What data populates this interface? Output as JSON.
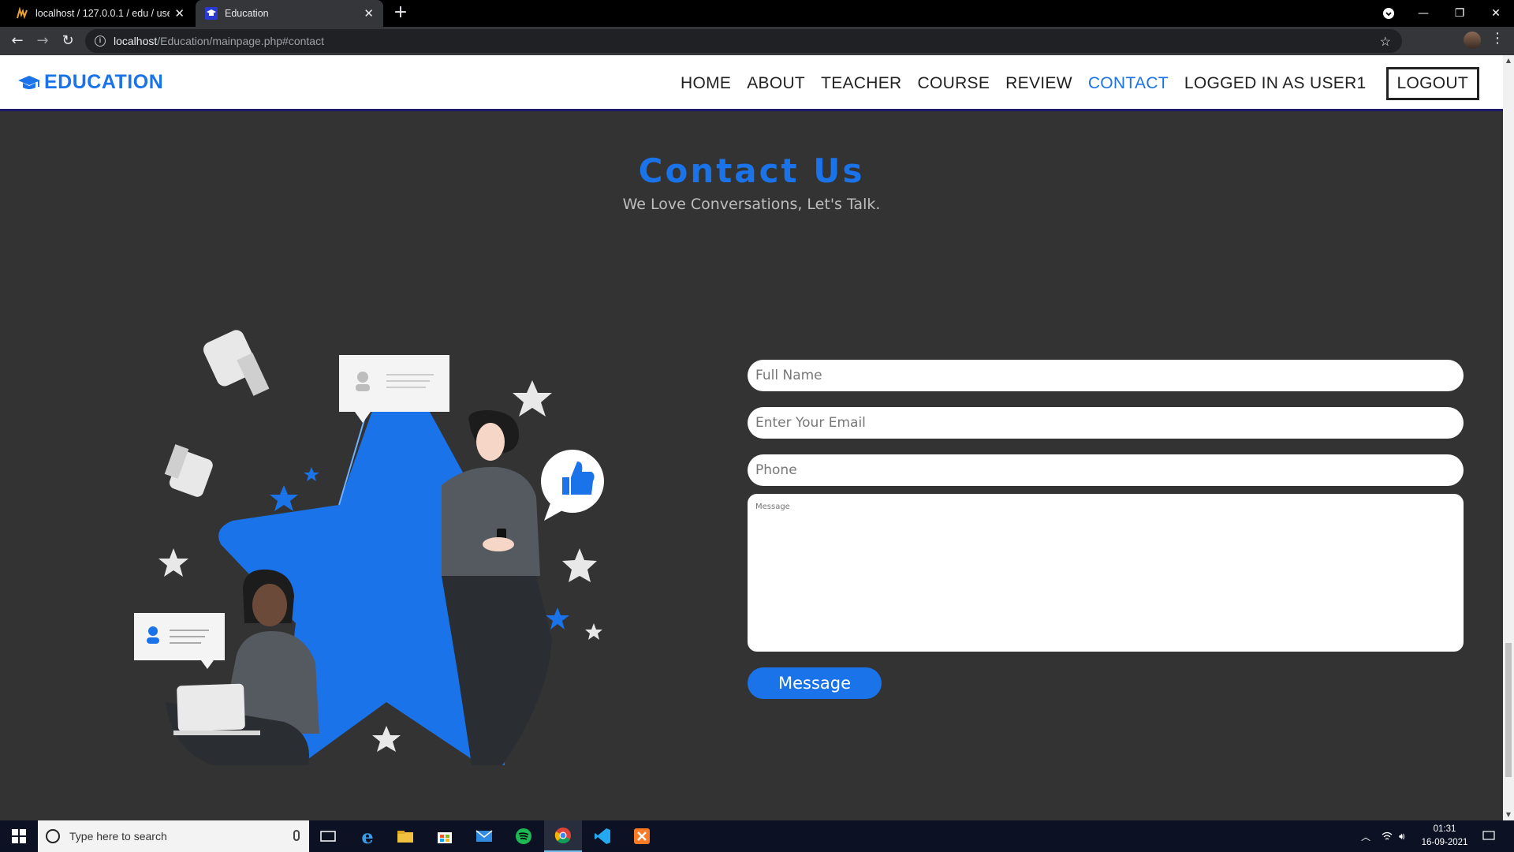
{
  "browser": {
    "tabs": [
      {
        "title": "localhost / 127.0.0.1 / edu / users",
        "active": false
      },
      {
        "title": "Education",
        "active": true
      }
    ],
    "url_host": "localhost",
    "url_path": "/Education/mainpage.php#contact"
  },
  "site": {
    "logo_text": "EDUCATION",
    "nav": [
      {
        "label": "HOME",
        "active": false
      },
      {
        "label": "ABOUT",
        "active": false
      },
      {
        "label": "TEACHER",
        "active": false
      },
      {
        "label": "COURSE",
        "active": false
      },
      {
        "label": "REVIEW",
        "active": false
      },
      {
        "label": "CONTACT",
        "active": true
      }
    ],
    "user_label": "LOGGED IN AS USER1",
    "logout_label": "LOGOUT"
  },
  "contact": {
    "title": "Contact Us",
    "subtitle": "We Love Conversations, Let's Talk.",
    "name_placeholder": "Full Name",
    "email_placeholder": "Enter Your Email",
    "phone_placeholder": "Phone",
    "message_placeholder": "Message",
    "submit_label": "Message"
  },
  "taskbar": {
    "search_placeholder": "Type here to search",
    "time": "01:31",
    "date": "16-09-2021"
  },
  "colors": {
    "accent": "#1a73e8",
    "page_bg": "#333333",
    "header_bg": "#ffffff"
  }
}
